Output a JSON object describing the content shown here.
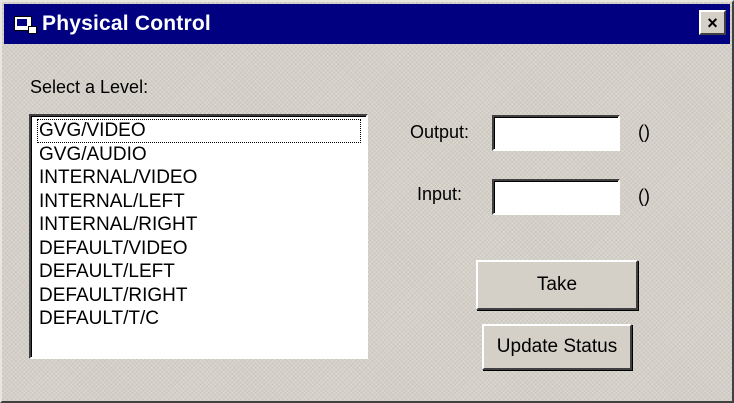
{
  "window": {
    "title": "Physical Control",
    "close_label": "×"
  },
  "level_label": "Select a Level:",
  "levels": [
    "GVG/VIDEO",
    "GVG/AUDIO",
    "INTERNAL/VIDEO",
    "INTERNAL/LEFT",
    "INTERNAL/RIGHT",
    "DEFAULT/VIDEO",
    "DEFAULT/LEFT",
    "DEFAULT/RIGHT",
    "DEFAULT/T/C"
  ],
  "output": {
    "label": "Output:",
    "value": "",
    "status": "()"
  },
  "input": {
    "label": "Input:",
    "value": "",
    "status": "()"
  },
  "buttons": {
    "take": "Take",
    "update_status": "Update Status"
  },
  "colors": {
    "title_bar": "#000080",
    "window_bg": "#d4d0c8"
  },
  "icons": {
    "app": "window-app-icon",
    "close": "close-icon"
  }
}
